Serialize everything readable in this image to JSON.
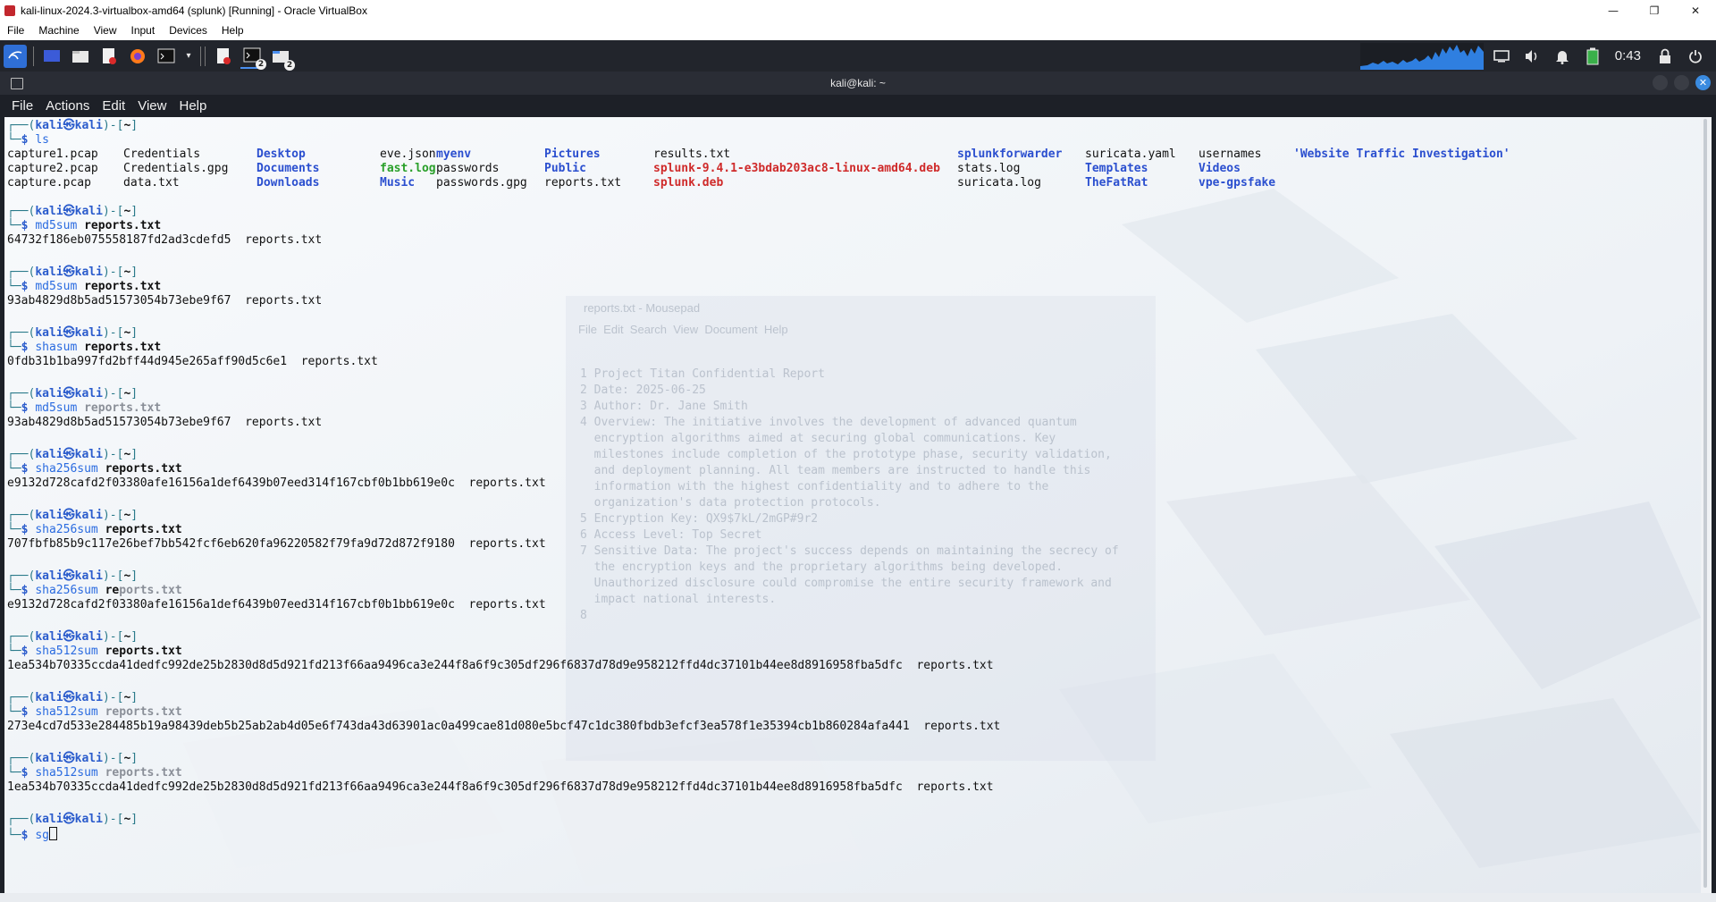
{
  "vbox": {
    "title": "kali-linux-2024.3-virtualbox-amd64 (splunk) [Running] - Oracle VirtualBox",
    "menus": [
      "File",
      "Machine",
      "View",
      "Input",
      "Devices",
      "Help"
    ],
    "window_buttons": {
      "minimize": "—",
      "maximize": "❐",
      "close": "✕"
    }
  },
  "panel": {
    "clock": "0:43",
    "badge_terminals": "2",
    "badge_files": "2"
  },
  "terminal": {
    "title": "kali@kali: ~",
    "menus": [
      "File",
      "Actions",
      "Edit",
      "View",
      "Help"
    ],
    "prompt": {
      "user": "kali",
      "host": "kali",
      "dir": "~",
      "at": "㉿"
    },
    "ls_command": "ls",
    "ls_output": [
      {
        "name": "capture1.pcap",
        "type": "file"
      },
      {
        "name": "capture2.pcap",
        "type": "file"
      },
      {
        "name": "capture.pcap",
        "type": "file"
      },
      {
        "name": "Credentials",
        "type": "file"
      },
      {
        "name": "Credentials.gpg",
        "type": "file"
      },
      {
        "name": "data.txt",
        "type": "file"
      },
      {
        "name": "Desktop",
        "type": "dir"
      },
      {
        "name": "Documents",
        "type": "dir"
      },
      {
        "name": "Downloads",
        "type": "dir"
      },
      {
        "name": "eve.json",
        "type": "file"
      },
      {
        "name": "fast.log",
        "type": "exe"
      },
      {
        "name": "Music",
        "type": "dir"
      },
      {
        "name": "myenv",
        "type": "dir"
      },
      {
        "name": "passwords",
        "type": "file"
      },
      {
        "name": "passwords.gpg",
        "type": "file"
      },
      {
        "name": "Pictures",
        "type": "dir"
      },
      {
        "name": "Public",
        "type": "dir"
      },
      {
        "name": "reports.txt",
        "type": "file"
      },
      {
        "name": "results.txt",
        "type": "file"
      },
      {
        "name": "splunk-9.4.1-e3bdab203ac8-linux-amd64.deb",
        "type": "deb"
      },
      {
        "name": "splunk.deb",
        "type": "deb"
      },
      {
        "name": "splunkforwarder",
        "type": "dir"
      },
      {
        "name": "stats.log",
        "type": "file"
      },
      {
        "name": "suricata.log",
        "type": "file"
      },
      {
        "name": "suricata.yaml",
        "type": "file"
      },
      {
        "name": "Templates",
        "type": "dir"
      },
      {
        "name": "TheFatRat",
        "type": "dir"
      },
      {
        "name": "usernames",
        "type": "file"
      },
      {
        "name": "Videos",
        "type": "dir"
      },
      {
        "name": "vpe-gpsfake",
        "type": "dir"
      },
      {
        "name": "'Website Traffic Investigation'",
        "type": "dir"
      }
    ],
    "commands": [
      {
        "cmd": "md5sum",
        "arg": "reports.txt",
        "arg_style": "bold",
        "output": "64732f186eb075558187fd2ad3cdefd5  reports.txt"
      },
      {
        "cmd": "md5sum",
        "arg": "reports.txt",
        "arg_style": "bold",
        "output": "93ab4829d8b5ad51573054b73ebe9f67  reports.txt"
      },
      {
        "cmd": "shasum",
        "arg": "reports.txt",
        "arg_style": "bold",
        "output": "0fdb31b1ba997fd2bff44d945e265aff90d5c6e1  reports.txt"
      },
      {
        "cmd": "md5sum",
        "arg": "reports.txt",
        "arg_style": "dim",
        "output": "93ab4829d8b5ad51573054b73ebe9f67  reports.txt"
      },
      {
        "cmd": "sha256sum",
        "arg": "reports.txt",
        "arg_style": "bold",
        "output": "e9132d728cafd2f03380afe16156a1def6439b07eed314f167cbf0b1bb619e0c  reports.txt"
      },
      {
        "cmd": "sha256sum",
        "arg": "reports.txt",
        "arg_style": "bold",
        "output": "707fbfb85b9c117e26bef7bb542fcf6eb620fa96220582f79fa9d72d872f9180  reports.txt"
      },
      {
        "cmd": "sha256sum",
        "arg": "reports.txt",
        "arg_style": "partial",
        "output": "e9132d728cafd2f03380afe16156a1def6439b07eed314f167cbf0b1bb619e0c  reports.txt"
      },
      {
        "cmd": "sha512sum",
        "arg": "reports.txt",
        "arg_style": "bold",
        "output": "1ea534b70335ccda41dedfc992de25b2830d8d5d921fd213f66aa9496ca3e244f8a6f9c305df296f6837d78d9e958212ffd4dc37101b44ee8d8916958fba5dfc  reports.txt"
      },
      {
        "cmd": "sha512sum",
        "arg": "reports.txt",
        "arg_style": "dim",
        "output": "273e4cd7d533e284485b19a98439deb5b25ab2ab4d05e6f743da43d63901ac0a499cae81d080e5bcf47c1dc380fbdb3efcf3ea578f1e35394cb1b860284afa441  reports.txt"
      },
      {
        "cmd": "sha512sum",
        "arg": "reports.txt",
        "arg_style": "dim",
        "output": "1ea534b70335ccda41dedfc992de25b2830d8d5d921fd213f66aa9496ca3e244f8a6f9c305df296f6837d78d9e958212ffd4dc37101b44ee8d8916958fba5dfc  reports.txt"
      }
    ],
    "current_input": "sg"
  },
  "ghost_editor": {
    "title": "reports.txt - Mousepad",
    "menu": "File  Edit  Search  View  Document  Help",
    "lines": [
      "1 Project Titan Confidential Report",
      "2 Date: 2025-06-25",
      "3 Author: Dr. Jane Smith",
      "4 Overview: The initiative involves the development of advanced quantum",
      "  encryption algorithms aimed at securing global communications. Key",
      "  milestones include completion of the prototype phase, security validation,",
      "  and deployment planning. All team members are instructed to handle this",
      "  information with the highest confidentiality and to adhere to the",
      "  organization's data protection protocols.",
      "5 Encryption Key: QX9$7kL/2mGP#9r2",
      "6 Access Level: Top Secret",
      "7 Sensitive Data: The project's success depends on maintaining the secrecy of",
      "  the encryption keys and the proprietary algorithms being developed.",
      "  Unauthorized disclosure could compromise the entire security framework and",
      "  impact national interests.",
      "8"
    ]
  },
  "colors": {
    "panel_bg": "#22252c",
    "terminal_bg": "#f7f9fc",
    "prompt_blue": "#2b5ccc",
    "dir_blue": "#2b4fcf",
    "deb_red": "#cf2a2a",
    "exe_green": "#2aa02a"
  }
}
